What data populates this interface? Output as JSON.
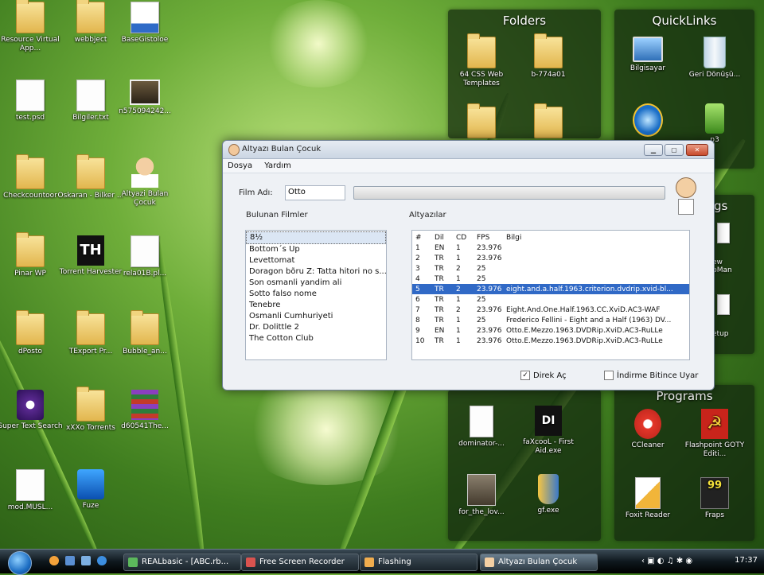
{
  "desktop": {
    "icons": [
      {
        "label": "Resource Virtual App...",
        "kind": "folder"
      },
      {
        "label": "webbject",
        "kind": "folder"
      },
      {
        "label": "BaseGistoloe",
        "kind": "word"
      },
      {
        "label": "test.psd",
        "kind": "paper"
      },
      {
        "label": "Bilgiler.txt",
        "kind": "paper"
      },
      {
        "label": "n575094242...",
        "kind": "photo"
      },
      {
        "label": "Checkcountoor",
        "kind": "folder"
      },
      {
        "label": "Oskaran - Bilker ...",
        "kind": "folder"
      },
      {
        "label": "Altyazi Bulan Çocuk",
        "kind": "boy"
      },
      {
        "label": "Pinar WP",
        "kind": "folder"
      },
      {
        "label": "Torrent Harvester",
        "kind": "th"
      },
      {
        "label": "rela01B.pl...",
        "kind": "paper"
      },
      {
        "label": "dPosto",
        "kind": "folder"
      },
      {
        "label": "TExport Pr...",
        "kind": "folder"
      },
      {
        "label": "Bubble_an...",
        "kind": "folder"
      },
      {
        "label": "Super Text Search",
        "kind": "eye"
      },
      {
        "label": "xXXo Torrents",
        "kind": "folder"
      },
      {
        "label": "d60541The...",
        "kind": "rar"
      },
      {
        "label": "mod.MUSL...",
        "kind": "paper"
      },
      {
        "label": "Fuze",
        "kind": "fuze"
      }
    ]
  },
  "gadgets": {
    "folders": {
      "title": "Folders",
      "items": [
        {
          "label": "64 CSS Web Templates"
        },
        {
          "label": "b-774a01"
        },
        {
          "label": ""
        },
        {
          "label": ""
        }
      ]
    },
    "quicklinks": {
      "title": "QuickLinks",
      "items": [
        {
          "label": "Bilgisayar"
        },
        {
          "label": "Geri Dönüşü..."
        },
        {
          "label": ""
        },
        {
          "label": "p3"
        }
      ]
    },
    "side": {
      "partial1": "gs",
      "partial2": "ew pMan",
      "partial3": "etup"
    },
    "middle": {
      "items": [
        {
          "label": "dominator-..."
        },
        {
          "label": "faXcooL - First Aid.exe"
        },
        {
          "label": "for_the_lov..."
        },
        {
          "label": "gf.exe"
        }
      ]
    },
    "programs": {
      "title": "Programs",
      "items": [
        {
          "label": "CCleaner"
        },
        {
          "label": "Flashpoint GOTY Editi..."
        },
        {
          "label": "Foxit Reader"
        },
        {
          "label": "Fraps"
        }
      ]
    }
  },
  "window": {
    "title": "Altyazı Bulan Çocuk",
    "menu": [
      "Dosya",
      "Yardım"
    ],
    "film_label": "Film Adı:",
    "film_value": "Otto",
    "found_label": "Bulunan Filmler",
    "subs_label": "Altyazılar",
    "films": [
      "8½",
      "Bottom´s Up",
      "Levettomat",
      "Doragon bõru Z: Tatta hitori no s...",
      "Son osmanli yandim ali",
      "Sotto falso nome",
      "Tenebre",
      "Osmanli Cumhuriyeti",
      "Dr. Dolittle 2",
      "The Cotton Club"
    ],
    "columns": [
      "#",
      "Dil",
      "CD",
      "FPS",
      "Bilgi"
    ],
    "subtitles": [
      [
        "1",
        "EN",
        "1",
        "23.976",
        ""
      ],
      [
        "2",
        "TR",
        "1",
        "23.976",
        ""
      ],
      [
        "3",
        "TR",
        "2",
        "25",
        ""
      ],
      [
        "4",
        "TR",
        "1",
        "25",
        ""
      ],
      [
        "5",
        "TR",
        "2",
        "23.976",
        "eight.and.a.half.1963.criterion.dvdrip.xvid-bl..."
      ],
      [
        "6",
        "TR",
        "1",
        "25",
        ""
      ],
      [
        "7",
        "TR",
        "2",
        "23.976",
        "Eight.And.One.Half.1963.CC.XviD.AC3-WAF"
      ],
      [
        "8",
        "TR",
        "1",
        "25",
        "Frederico Fellini - Eight and a Half (1963) DV..."
      ],
      [
        "9",
        "EN",
        "1",
        "23.976",
        "Otto.E.Mezzo.1963.DVDRip.XviD.AC3-RuLLe"
      ],
      [
        "10",
        "TR",
        "1",
        "23.976",
        "Otto.E.Mezzo.1963.DVDRip.XviD.AC3-RuLLe"
      ]
    ],
    "selected_row": 5,
    "check_direct": {
      "label": "Direk Aç",
      "checked": true
    },
    "check_sleep": {
      "label": "İndirme Bitince Uyar",
      "checked": false
    }
  },
  "taskbar": {
    "tasks": [
      {
        "label": "REALbasic - [ABC.rb...",
        "active": false
      },
      {
        "label": "Free Screen Recorder",
        "active": false
      },
      {
        "label": "Flashing",
        "active": false
      },
      {
        "label": "Altyazı Bulan Çocuk",
        "active": true
      }
    ],
    "clock": "17:37"
  }
}
